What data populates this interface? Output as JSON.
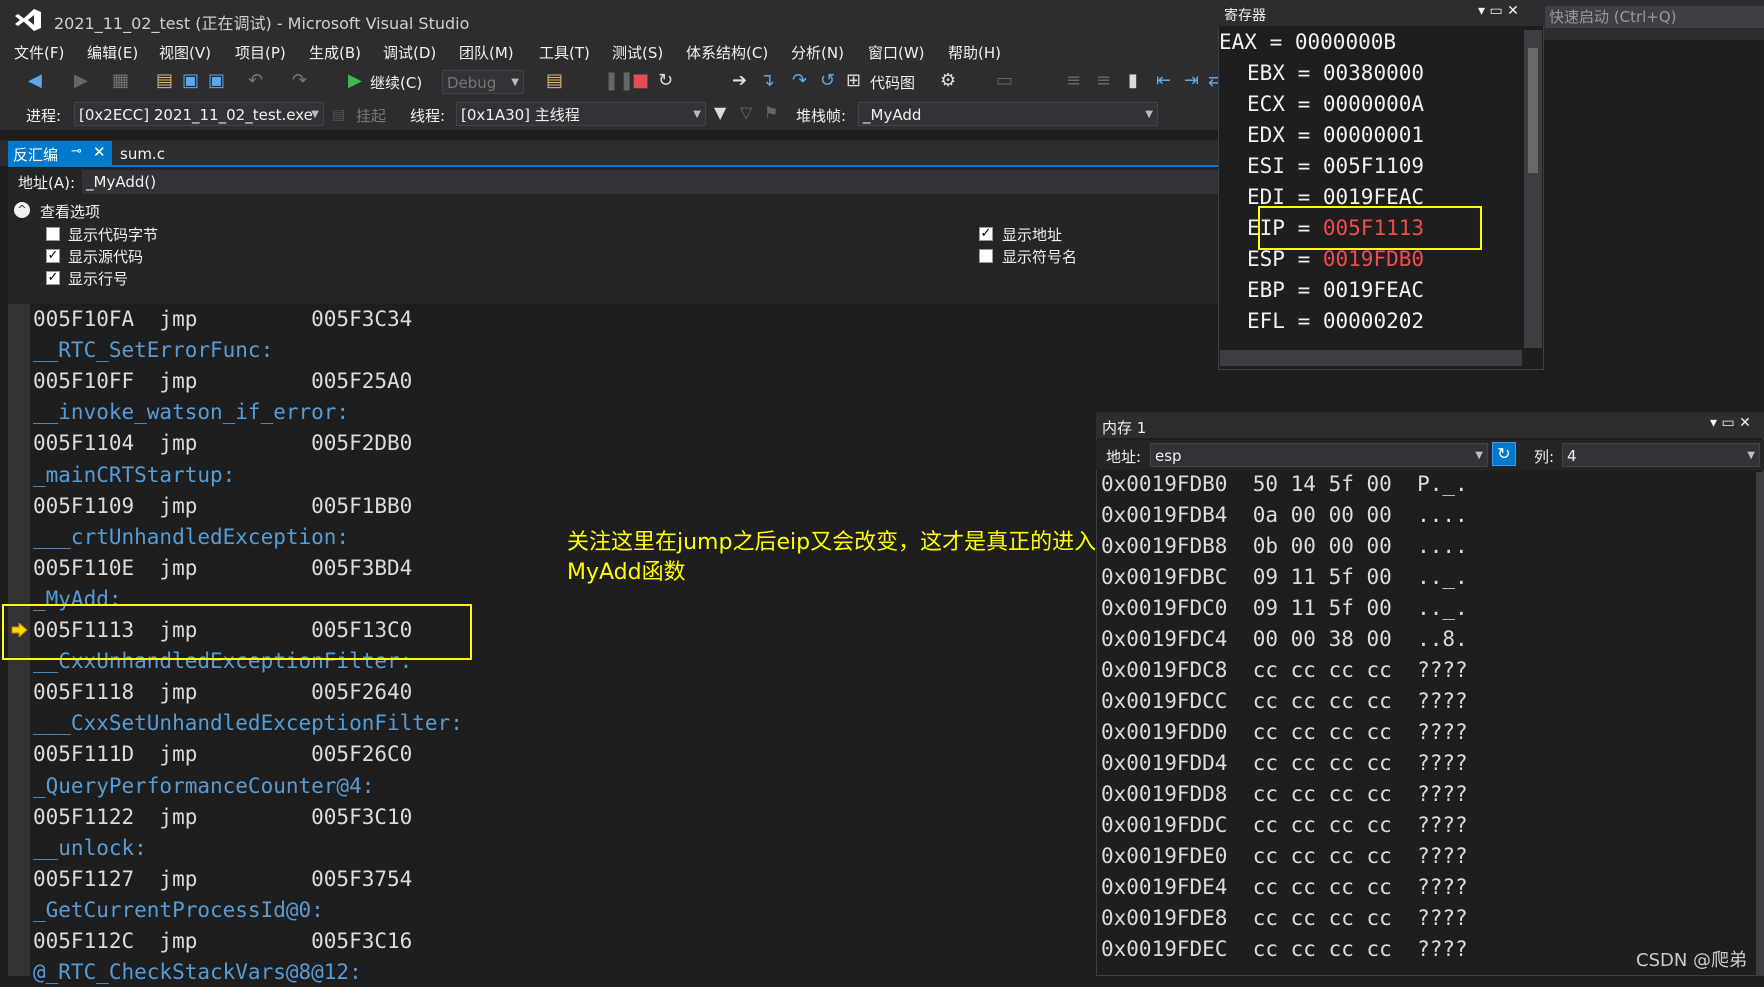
{
  "window": {
    "title": "2021_11_02_test (正在调试) - Microsoft Visual Studio",
    "quick_launch": "快速启动 (Ctrl+Q)"
  },
  "menu": [
    "文件(F)",
    "编辑(E)",
    "视图(V)",
    "项目(P)",
    "生成(B)",
    "调试(D)",
    "团队(M)",
    "工具(T)",
    "测试(S)",
    "体系结构(C)",
    "分析(N)",
    "窗口(W)",
    "帮助(H)"
  ],
  "toolbar": {
    "continue_label": "继续(C)",
    "config": "Debug",
    "code_map_label": "代码图",
    "process_label": "进程:",
    "process_value": "[0x2ECC] 2021_11_02_test.exe",
    "suspend_label": "挂起",
    "thread_label": "线程:",
    "thread_value": "[0x1A30] 主线程",
    "stackframe_label": "堆栈帧:",
    "stackframe_value": "_MyAdd"
  },
  "tabs": {
    "disasm": "反汇编",
    "pin": "⊸",
    "close": "✕",
    "sum": "sum.c"
  },
  "address_bar": {
    "label": "地址(A):",
    "value": "_MyAdd()"
  },
  "options": {
    "toggle": "^",
    "title": "查看选项",
    "items": [
      {
        "label": "显示代码字节",
        "checked": false
      },
      {
        "label": "显示源代码",
        "checked": true
      },
      {
        "label": "显示行号",
        "checked": true
      },
      {
        "label": "显示地址",
        "checked": true
      },
      {
        "label": "显示符号名",
        "checked": false
      }
    ],
    "check_mark": "✓"
  },
  "disasm_lines": [
    {
      "kind": "code",
      "text": "005F10FA  jmp         005F3C34"
    },
    {
      "kind": "label",
      "text": "__RTC_SetErrorFunc:"
    },
    {
      "kind": "code",
      "text": "005F10FF  jmp         005F25A0"
    },
    {
      "kind": "label",
      "text": "__invoke_watson_if_error:"
    },
    {
      "kind": "code",
      "text": "005F1104  jmp         005F2DB0"
    },
    {
      "kind": "label",
      "text": "_mainCRTStartup:"
    },
    {
      "kind": "code",
      "text": "005F1109  jmp         005F1BB0"
    },
    {
      "kind": "label",
      "text": "___crtUnhandledException:"
    },
    {
      "kind": "code",
      "text": "005F110E  jmp         005F3BD4"
    },
    {
      "kind": "label",
      "text": "_MyAdd:"
    },
    {
      "kind": "code",
      "text": "005F1113  jmp         005F13C0"
    },
    {
      "kind": "label",
      "text": "__CxxUnhandledExceptionFilter:"
    },
    {
      "kind": "code",
      "text": "005F1118  jmp         005F2640"
    },
    {
      "kind": "label",
      "text": "___CxxSetUnhandledExceptionFilter:"
    },
    {
      "kind": "code",
      "text": "005F111D  jmp         005F26C0"
    },
    {
      "kind": "label",
      "text": "_QueryPerformanceCounter@4:"
    },
    {
      "kind": "code",
      "text": "005F1122  jmp         005F3C10"
    },
    {
      "kind": "label",
      "text": "__unlock:"
    },
    {
      "kind": "code",
      "text": "005F1127  jmp         005F3754"
    },
    {
      "kind": "label",
      "text": "_GetCurrentProcessId@0:"
    },
    {
      "kind": "code",
      "text": "005F112C  jmp         005F3C16"
    },
    {
      "kind": "label",
      "text": "@_RTC_CheckStackVars@8@12:"
    }
  ],
  "current_line_index": 10,
  "annotation": {
    "line1": "关注这里在jump之后eip又会改变，这才是真正的进入到了",
    "line2": "MyAdd函数"
  },
  "registers": {
    "title": "寄存器",
    "title_buttons": "▾ ▭ ✕",
    "items": [
      {
        "name": "EAX",
        "value": "0000000B",
        "changed": false
      },
      {
        "name": "EBX",
        "value": "00380000",
        "changed": false
      },
      {
        "name": "ECX",
        "value": "0000000A",
        "changed": false
      },
      {
        "name": "EDX",
        "value": "00000001",
        "changed": false
      },
      {
        "name": "ESI",
        "value": "005F1109",
        "changed": false
      },
      {
        "name": "EDI",
        "value": "0019FEAC",
        "changed": false
      },
      {
        "name": "EIP",
        "value": "005F1113",
        "changed": true
      },
      {
        "name": "ESP",
        "value": "0019FDB0",
        "changed": true
      },
      {
        "name": "EBP",
        "value": "0019FEAC",
        "changed": false
      },
      {
        "name": "EFL",
        "value": "00000202",
        "changed": false
      }
    ]
  },
  "memory": {
    "title": "内存 1",
    "title_buttons": "▾ ▭ ✕",
    "addr_label": "地址:",
    "addr_value": "esp",
    "refresh": "↻",
    "col_label": "列:",
    "col_value": "4",
    "rows": [
      {
        "addr": "0x0019FDB0",
        "bytes": "50 14 5f 00",
        "ascii": "P._."
      },
      {
        "addr": "0x0019FDB4",
        "bytes": "0a 00 00 00",
        "ascii": "...."
      },
      {
        "addr": "0x0019FDB8",
        "bytes": "0b 00 00 00",
        "ascii": "...."
      },
      {
        "addr": "0x0019FDBC",
        "bytes": "09 11 5f 00",
        "ascii": ".._."
      },
      {
        "addr": "0x0019FDC0",
        "bytes": "09 11 5f 00",
        "ascii": ".._."
      },
      {
        "addr": "0x0019FDC4",
        "bytes": "00 00 38 00",
        "ascii": "..8."
      },
      {
        "addr": "0x0019FDC8",
        "bytes": "cc cc cc cc",
        "ascii": "????"
      },
      {
        "addr": "0x0019FDCC",
        "bytes": "cc cc cc cc",
        "ascii": "????"
      },
      {
        "addr": "0x0019FDD0",
        "bytes": "cc cc cc cc",
        "ascii": "????"
      },
      {
        "addr": "0x0019FDD4",
        "bytes": "cc cc cc cc",
        "ascii": "????"
      },
      {
        "addr": "0x0019FDD8",
        "bytes": "cc cc cc cc",
        "ascii": "????"
      },
      {
        "addr": "0x0019FDDC",
        "bytes": "cc cc cc cc",
        "ascii": "????"
      },
      {
        "addr": "0x0019FDE0",
        "bytes": "cc cc cc cc",
        "ascii": "????"
      },
      {
        "addr": "0x0019FDE4",
        "bytes": "cc cc cc cc",
        "ascii": "????"
      },
      {
        "addr": "0x0019FDE8",
        "bytes": "cc cc cc cc",
        "ascii": "????"
      },
      {
        "addr": "0x0019FDEC",
        "bytes": "cc cc cc cc",
        "ascii": "????"
      }
    ]
  },
  "watermark": "CSDN @爬弟",
  "colors": {
    "accent": "#007acc",
    "highlight": "#ffff00",
    "changed_value": "#f14c4c",
    "label": "#569cd6"
  }
}
